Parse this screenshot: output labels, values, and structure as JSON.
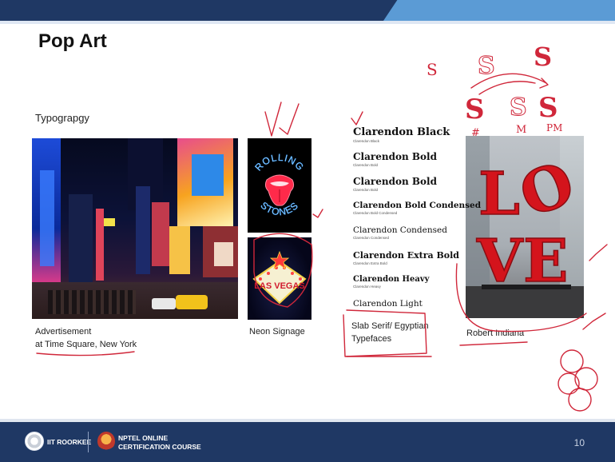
{
  "slide": {
    "title": "Pop Art",
    "subtitle": "Typograpgy",
    "page_number": "10"
  },
  "images": {
    "rolling_text_top": "ROLLING",
    "rolling_text_bottom": "STONES",
    "vegas_text": "LAS VEGAS",
    "love_letters": [
      "L",
      "O",
      "V",
      "E"
    ]
  },
  "captions": {
    "times_square_line1": "Advertisement",
    "times_square_line2": "at Time Square, New York",
    "neon": "Neon Signage",
    "slab_line1": "Slab Serif/ Egyptian",
    "slab_line2": "Typefaces",
    "robert": "Robert Indiana"
  },
  "fonts": [
    {
      "name": "Clarendon Black",
      "sub": "Clarendon Black"
    },
    {
      "name": "Clarendon Bold",
      "sub": "Clarendon Bold"
    },
    {
      "name": "Clarendon Bold",
      "sub": "Clarendon Bold"
    },
    {
      "name": "Clarendon Bold Condensed",
      "sub": "Clarendon Bold Condensed"
    },
    {
      "name": "Clarendon Condensed",
      "sub": "Clarendon Condensed"
    },
    {
      "name": "Clarendon Extra Bold",
      "sub": "Clarendon Extra Bold"
    },
    {
      "name": "Clarendon Heavy",
      "sub": "Clarendon Heavy"
    },
    {
      "name": "Clarendon Light",
      "sub": ""
    }
  ],
  "footer": {
    "iit": "IIT ROORKEE",
    "nptel_line1": "NPTEL ONLINE",
    "nptel_line2": "CERTIFICATION COURSE"
  },
  "annotations": {
    "s_small": "S",
    "s_outline": "S",
    "s_red_top": "S",
    "s_red_left": "S",
    "s_mid": "S",
    "s_red_right": "S",
    "label_hash": "#",
    "label_m": "M",
    "label_pm": "PM"
  },
  "colors": {
    "navy": "#1f3864",
    "accent_blue": "#5b9bd5",
    "ink_red": "#d0273a",
    "love_red": "#d4141c"
  }
}
